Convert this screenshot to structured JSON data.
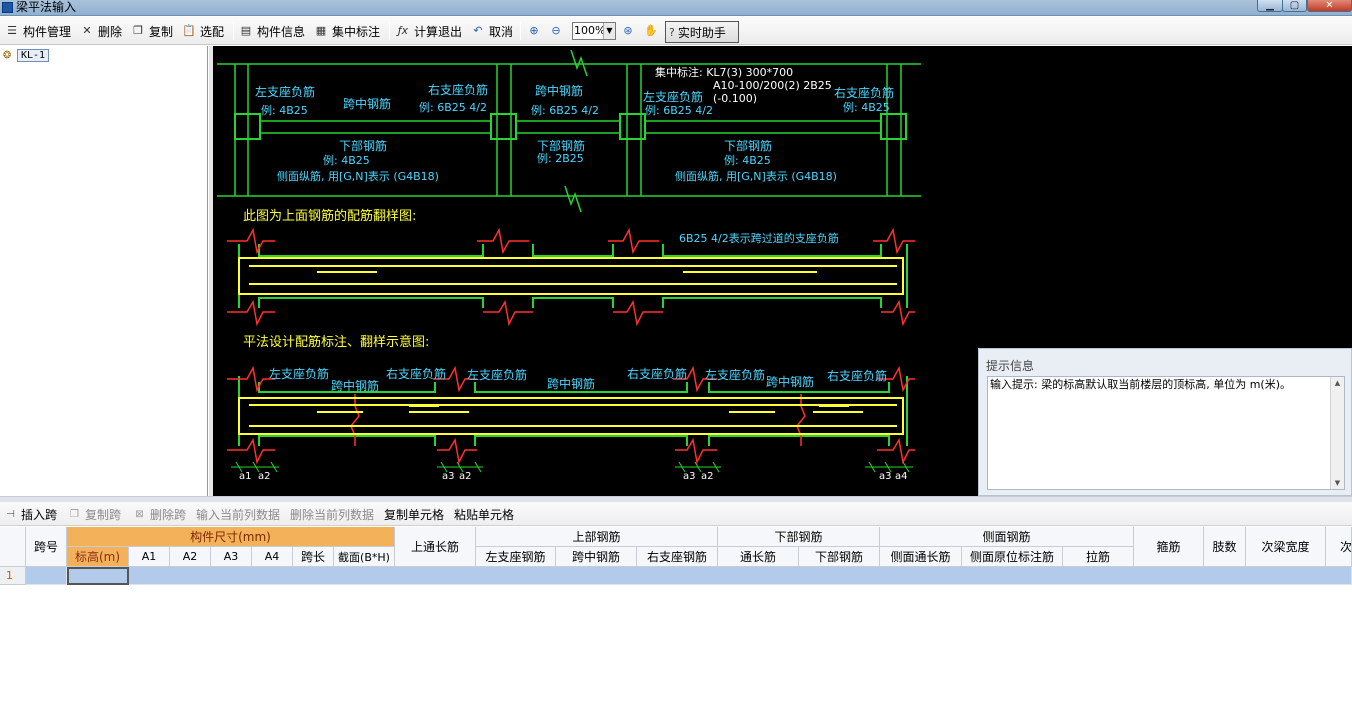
{
  "window": {
    "title": "梁平法输入"
  },
  "toolbar": {
    "items": [
      {
        "label": "构件管理",
        "icon": "list-icon"
      },
      {
        "label": "删除",
        "icon": "x-icon"
      },
      {
        "label": "复制",
        "icon": "copy-icon"
      },
      {
        "label": "选配",
        "icon": "clipboard-icon"
      },
      {
        "label": "构件信息",
        "icon": "info-icon"
      },
      {
        "label": "集中标注",
        "icon": "table-icon"
      },
      {
        "label": "计算退出",
        "icon": "fx-icon"
      },
      {
        "label": "取消",
        "icon": "undo-icon"
      }
    ],
    "zoom_value": "100%",
    "helper_label": "实时助手"
  },
  "tree": {
    "nodes": [
      {
        "label": "KL-1"
      }
    ]
  },
  "drawing": {
    "diagram_top": {
      "left_support_title": "左支座负筋",
      "left_support_example": "例: 4B25",
      "mid_span_title": "跨中钢筋",
      "right_support_title": "右支座负筋",
      "right_support_example": "例: 6B25 4/2",
      "mid_span2_title": "跨中钢筋",
      "mid_span2_example": "例: 6B25 4/2",
      "bottom1_title": "下部钢筋",
      "bottom1_example": "例: 4B25",
      "side_note1": "侧面纵筋, 用[G,N]表示 (G4B18)",
      "bottom2_title": "下部钢筋",
      "bottom2_example": "例: 2B25",
      "concentrated_label": "集中标注: KL7(3) 300*700",
      "concentrated_line2": "A10-100/200(2) 2B25",
      "concentrated_line3": "(-0.100)",
      "left_support2_title": "左支座负筋",
      "left_support2_example": "例: 6B25 4/2",
      "right_support2_title": "右支座负筋",
      "right_support2_example": "例: 4B25",
      "bottom3_title": "下部钢筋",
      "bottom3_example": "例: 4B25",
      "side_note2": "侧面纵筋, 用[G,N]表示 (G4B18)"
    },
    "caption1": "此图为上面钢筋的配筋翻样图:",
    "diagram_mid_note": "6B25 4/2表示跨过道的支座负筋",
    "caption2": "平法设计配筋标注、翻样示意图:",
    "diagram_bottom": {
      "labels": [
        "左支座负筋",
        "跨中钢筋",
        "右支座负筋",
        "左支座负筋",
        "跨中钢筋",
        "右支座负筋",
        "左支座负筋",
        "跨中钢筋",
        "右支座负筋"
      ],
      "dims": [
        "a1",
        "a2",
        "a3",
        "a2",
        "a3",
        "a2",
        "a3",
        "a4"
      ]
    }
  },
  "hint_panel": {
    "title": "提示信息",
    "text": "输入提示: 梁的标高默认取当前楼层的顶标高, 单位为 m(米)。"
  },
  "table_toolbar": {
    "insert_span": "插入跨",
    "copy_span": "复制跨",
    "delete_span": "删除跨",
    "input_col": "输入当前列数据",
    "delete_col": "删除当前列数据",
    "copy_cell": "复制单元格",
    "paste_cell": "粘贴单元格"
  },
  "table": {
    "headers": {
      "span_no": "跨号",
      "size_group": "构件尺寸(mm)",
      "elevation": "标高(m)",
      "a1": "A1",
      "a2": "A2",
      "a3": "A3",
      "a4": "A4",
      "span_len": "跨长",
      "section": "截面(B*H)",
      "top_through": "上通长筋",
      "top_group": "上部钢筋",
      "left_support": "左支座钢筋",
      "mid_span": "跨中钢筋",
      "right_support": "右支座钢筋",
      "bottom_group": "下部钢筋",
      "bottom_through": "通长筋",
      "bottom_bars": "下部钢筋",
      "side_group": "侧面钢筋",
      "side_through": "侧面通长筋",
      "side_local": "侧面原位标注筋",
      "tie": "拉筋",
      "stirrup": "箍筋",
      "legs": "肢数",
      "sec_width": "次梁宽度",
      "sec_more": "次"
    },
    "rows": [
      {
        "no": "1"
      }
    ]
  }
}
